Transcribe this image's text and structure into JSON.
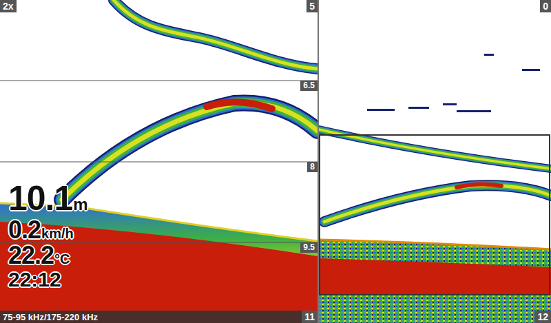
{
  "left_pane": {
    "zoom": "2x",
    "depth_top": "5",
    "depth_lines": [
      "6.5",
      "8",
      "9.5"
    ],
    "depth_bottom": "11",
    "frequency": "75-95 kHz/175-220 kHz"
  },
  "right_pane": {
    "depth_top": "0",
    "depth_bottom": "12"
  },
  "readouts": [
    {
      "kind": "depth",
      "value": "10.1",
      "unit": "m"
    },
    {
      "kind": "speed",
      "value": "0.2",
      "unit": "km/h"
    },
    {
      "kind": "temperature",
      "value": "22.2",
      "unit": "°C"
    }
  ],
  "clock": "22:12"
}
